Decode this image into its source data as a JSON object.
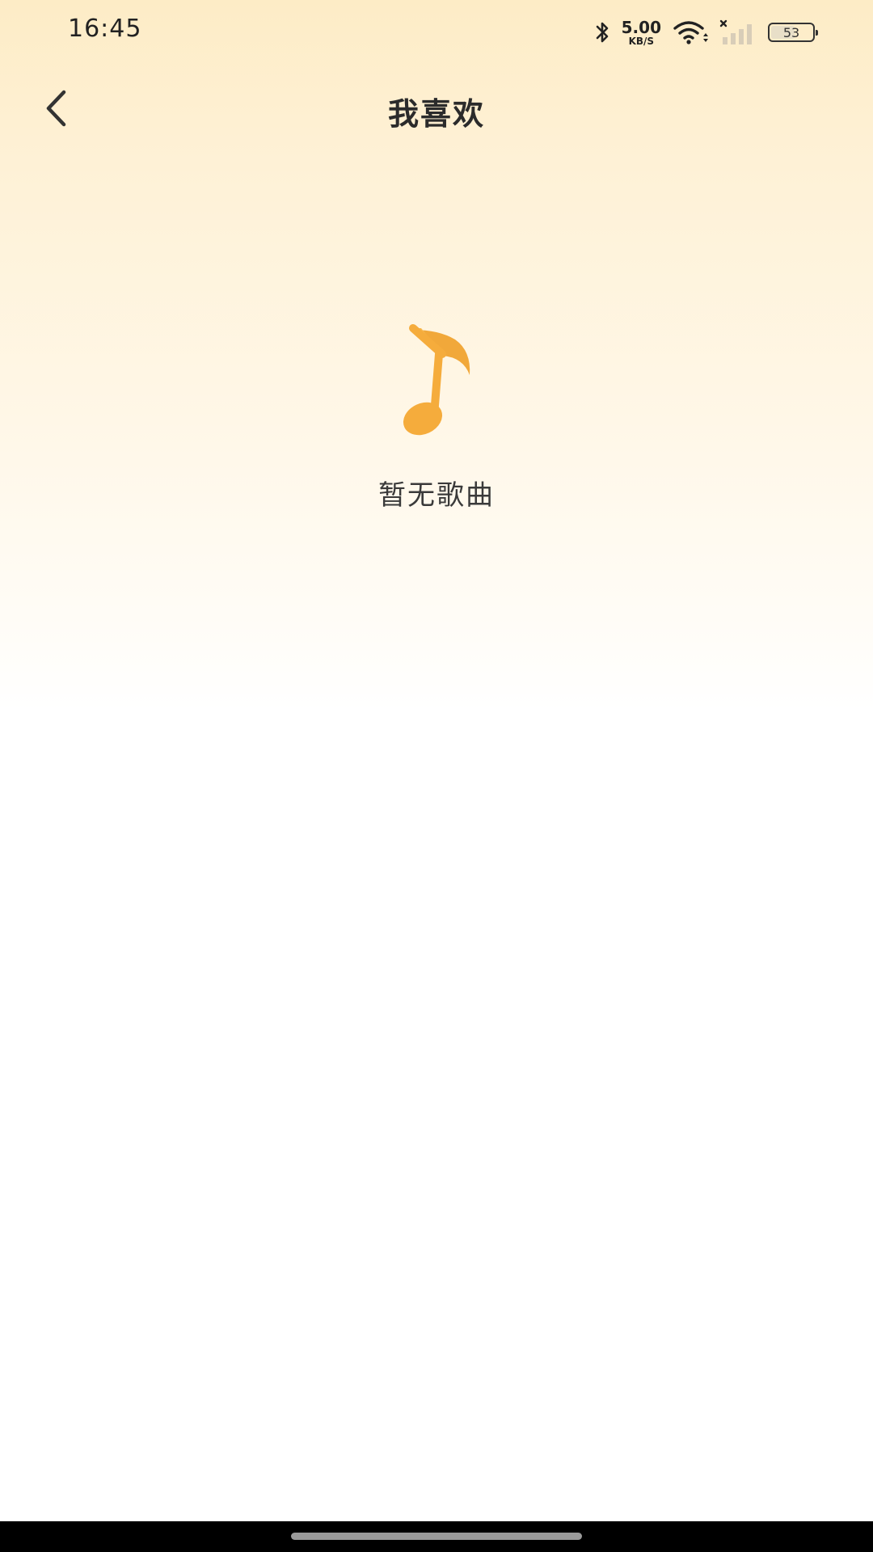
{
  "status_bar": {
    "time": "16:45",
    "net_speed_value": "5.00",
    "net_speed_unit": "KB/S",
    "battery_level": "53",
    "icons": [
      "bluetooth-icon",
      "wifi-icon",
      "signal-icon",
      "battery-icon"
    ]
  },
  "header": {
    "title": "我喜欢",
    "back_icon": "chevron-left-icon"
  },
  "empty_state": {
    "icon": "music-note-icon",
    "message": "暂无歌曲"
  },
  "colors": {
    "accent": "#F5AC3C",
    "background_top": "#FDECC6",
    "background_bottom": "#FFFFFF",
    "text_primary": "#2B2B2B"
  }
}
